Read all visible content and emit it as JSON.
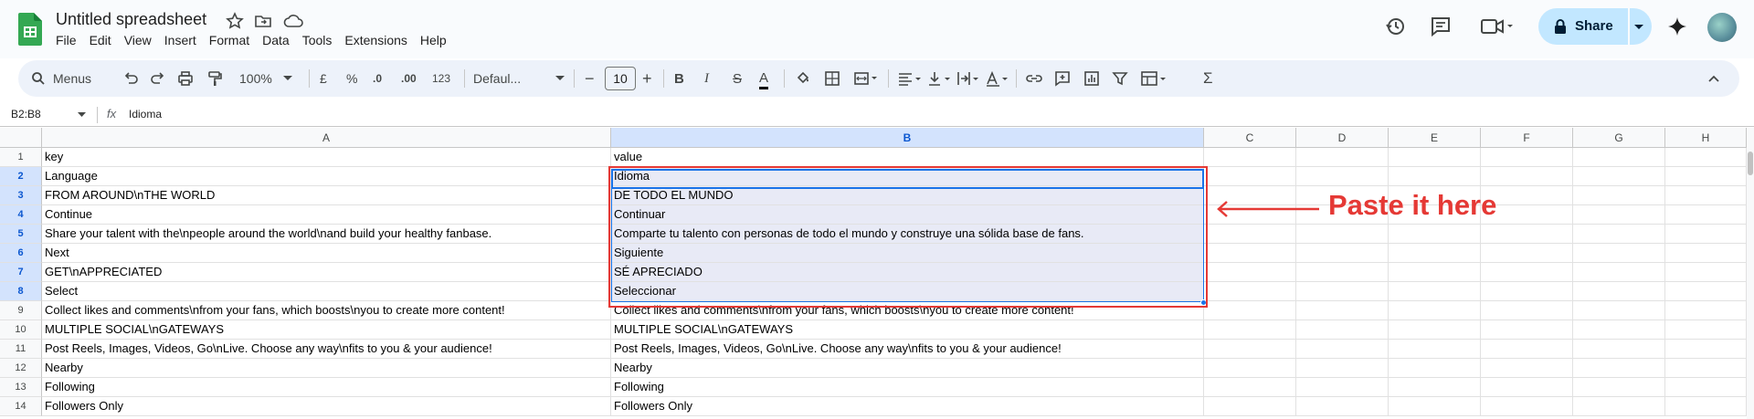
{
  "app": {
    "title": "Untitled spreadsheet",
    "menu": [
      "File",
      "Edit",
      "View",
      "Insert",
      "Format",
      "Data",
      "Tools",
      "Extensions",
      "Help"
    ],
    "share_label": "Share"
  },
  "toolbar": {
    "search_label": "Menus",
    "zoom": "100%",
    "currency": "£",
    "percent": "%",
    "dec_decrease": ".0",
    "dec_increase": ".00",
    "number_format": "123",
    "font": "Defaul...",
    "font_size": "10",
    "bold": "B",
    "italic": "I",
    "strike": "S",
    "text_color": "A",
    "sum": "Σ"
  },
  "formula_bar": {
    "name_box": "B2:B8",
    "fx": "fx",
    "value": "Idioma"
  },
  "columns": [
    "A",
    "B",
    "C",
    "D",
    "E",
    "F",
    "G",
    "H"
  ],
  "selected_column": "B",
  "selected_rows": [
    2,
    3,
    4,
    5,
    6,
    7,
    8
  ],
  "rows": [
    {
      "num": "1",
      "a": "key",
      "b": "value"
    },
    {
      "num": "2",
      "a": "Language",
      "b": "Idioma"
    },
    {
      "num": "3",
      "a": "FROM AROUND\\nTHE WORLD",
      "b": "DE TODO EL MUNDO"
    },
    {
      "num": "4",
      "a": "Continue",
      "b": "Continuar"
    },
    {
      "num": "5",
      "a": "Share your talent with the\\npeople around the world\\nand build your healthy fanbase.",
      "b": "Comparte tu talento con personas de todo el mundo y construye una sólida base de fans."
    },
    {
      "num": "6",
      "a": "Next",
      "b": "Siguiente"
    },
    {
      "num": "7",
      "a": "GET\\nAPPRECIATED",
      "b": "SÉ APRECIADO"
    },
    {
      "num": "8",
      "a": "Select",
      "b": "Seleccionar"
    },
    {
      "num": "9",
      "a": "Collect likes and comments\\nfrom your fans, which boosts\\nyou to create more content!",
      "b": "Collect likes and comments\\nfrom your fans, which boosts\\nyou to create more content!"
    },
    {
      "num": "10",
      "a": "MULTIPLE SOCIAL\\nGATEWAYS",
      "b": "MULTIPLE SOCIAL\\nGATEWAYS"
    },
    {
      "num": "11",
      "a": "Post Reels, Images, Videos, Go\\nLive. Choose any way\\nfits to you & your audience!",
      "b": "Post Reels, Images, Videos, Go\\nLive. Choose any way\\nfits to you & your audience!"
    },
    {
      "num": "12",
      "a": "Nearby",
      "b": "Nearby"
    },
    {
      "num": "13",
      "a": "Following",
      "b": "Following"
    },
    {
      "num": "14",
      "a": "Followers Only",
      "b": "Followers Only"
    }
  ],
  "annotation": "Paste it here",
  "colors": {
    "accent": "#1a73e8",
    "annotation": "#e53935",
    "share_bg": "#c2e7ff",
    "selection_fill": "#e8eaf6"
  }
}
